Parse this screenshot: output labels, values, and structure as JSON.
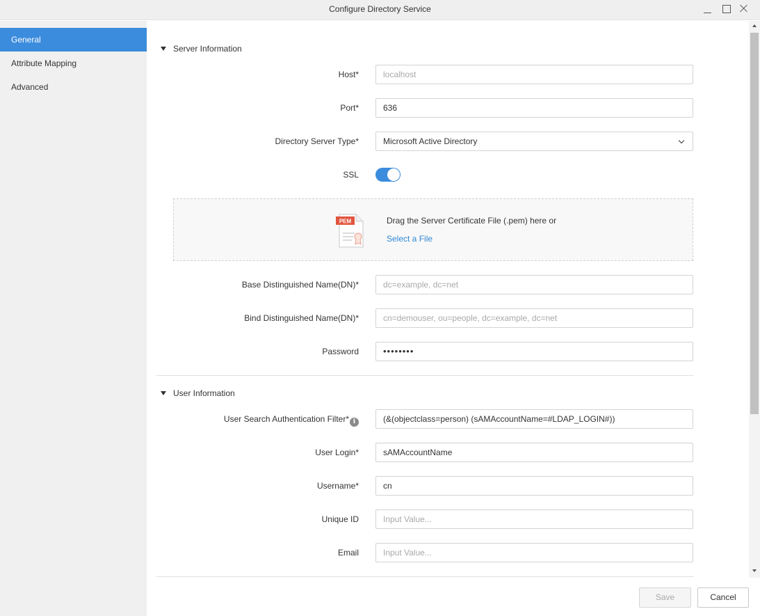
{
  "window": {
    "title": "Configure Directory Service"
  },
  "sidebar": {
    "items": [
      {
        "label": "General"
      },
      {
        "label": "Attribute Mapping"
      },
      {
        "label": "Advanced"
      }
    ]
  },
  "server_info": {
    "heading": "Server Information",
    "host": {
      "label": "Host*",
      "placeholder": "localhost"
    },
    "port": {
      "label": "Port*",
      "value": "636"
    },
    "server_type": {
      "label": "Directory Server Type*",
      "value": "Microsoft Active Directory"
    },
    "ssl": {
      "label": "SSL",
      "enabled": true
    },
    "certificate": {
      "badge": "PEM",
      "drag_text": "Drag the Server Certificate File (.pem) here or",
      "select_link": "Select a File"
    },
    "base_dn": {
      "label": "Base Distinguished Name(DN)*",
      "placeholder": "dc=example, dc=net"
    },
    "bind_dn": {
      "label": "Bind Distinguished Name(DN)*",
      "placeholder": "cn=demouser, ou=people, dc=example, dc=net"
    },
    "password": {
      "label": "Password",
      "value": "••••••••"
    }
  },
  "user_info": {
    "heading": "User Information",
    "search_filter": {
      "label": "User Search Authentication Filter*",
      "value": "(&(objectclass=person) (sAMAccountName=#LDAP_LOGIN#))"
    },
    "user_login": {
      "label": "User Login*",
      "value": "sAMAccountName"
    },
    "username": {
      "label": "Username*",
      "value": "cn"
    },
    "unique_id": {
      "label": "Unique ID",
      "placeholder": "Input Value..."
    },
    "email": {
      "label": "Email",
      "placeholder": "Input Value..."
    }
  },
  "footer": {
    "save_label": "Save",
    "cancel_label": "Cancel"
  },
  "colors": {
    "accent": "#3b8cdd",
    "link": "#2d87d6",
    "pem_badge": "#e0553f"
  }
}
